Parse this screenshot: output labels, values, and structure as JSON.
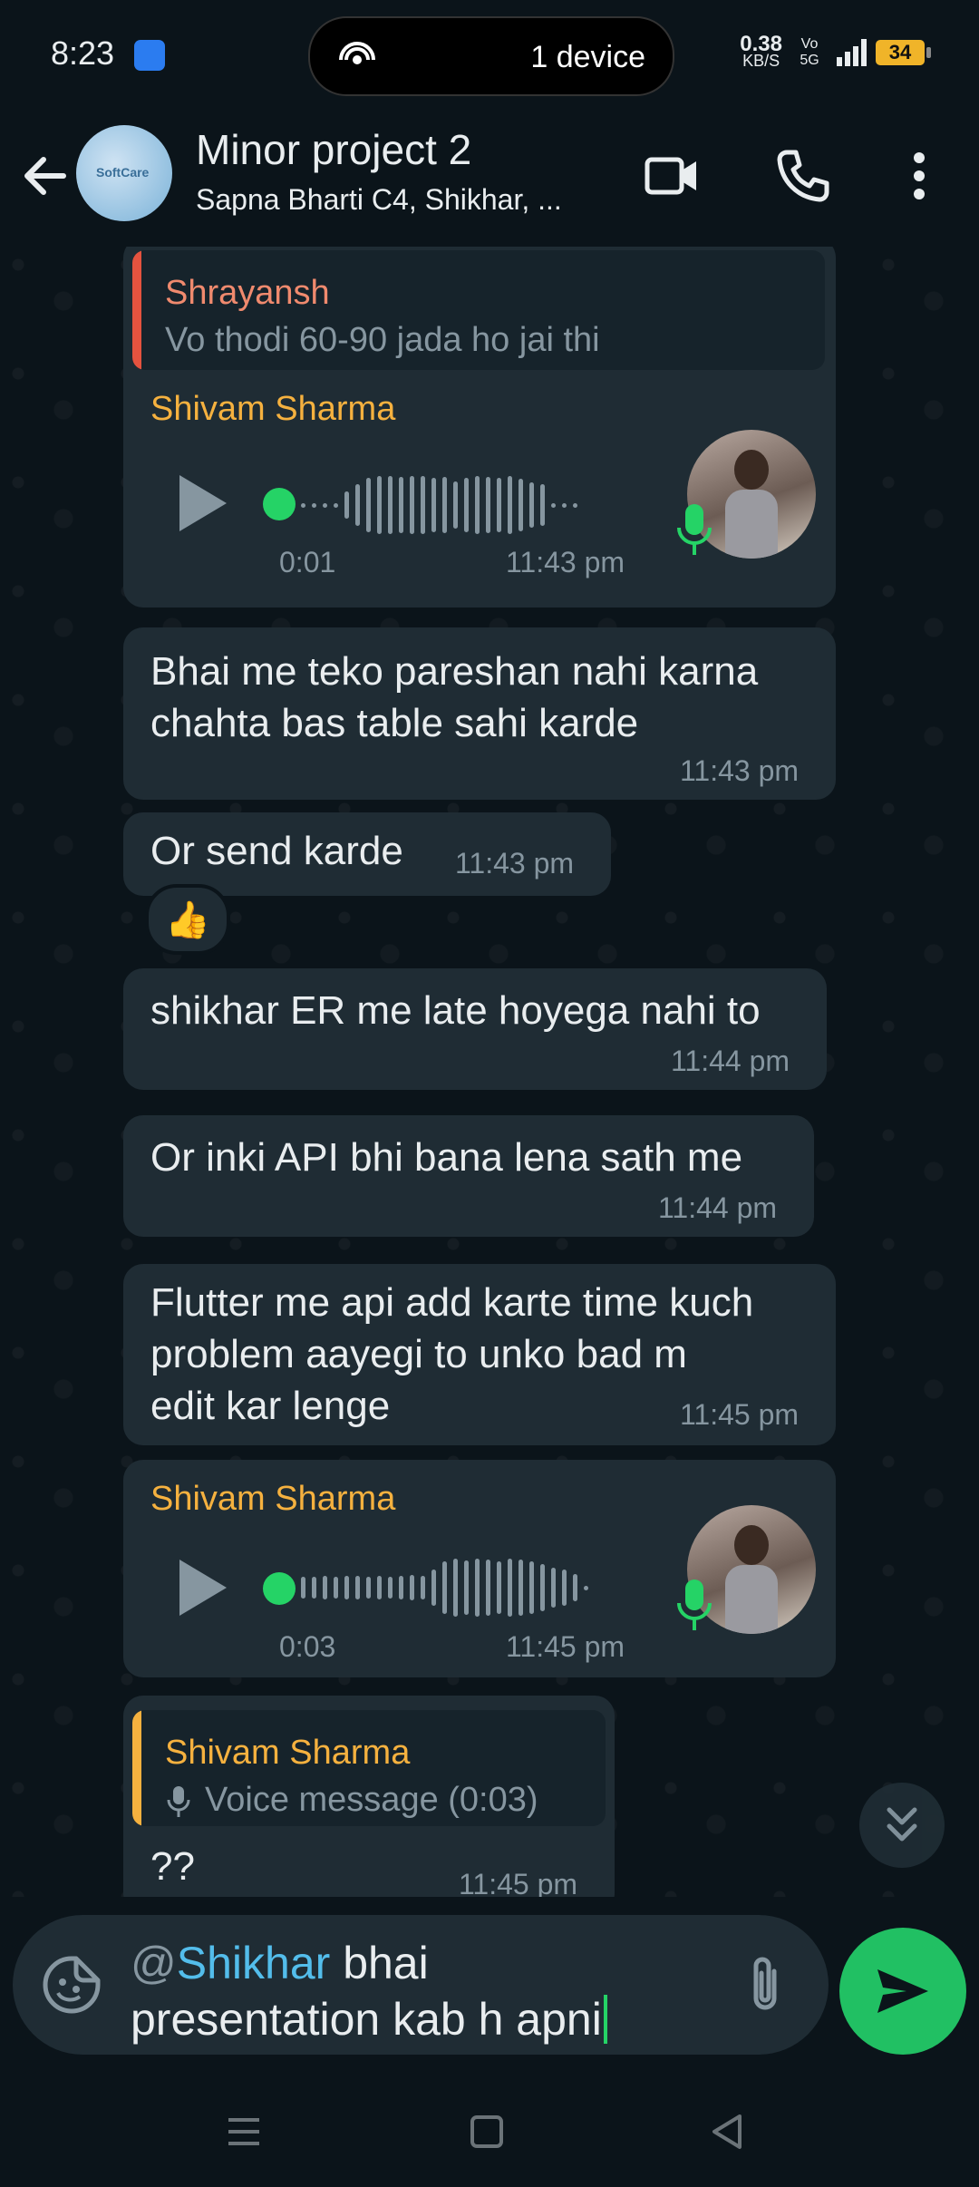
{
  "status_bar": {
    "time": "8:23",
    "device_label": "1 device",
    "net_speed": "0.38",
    "net_unit": "KB/S",
    "volte": "Vo 5G",
    "network": "5G",
    "battery": "34"
  },
  "header": {
    "avatar_text": "SoftCare",
    "title": "Minor project 2",
    "subtitle": "Sapna Bharti C4, Shikhar, ..."
  },
  "messages": [
    {
      "quote_name": "Shrayansh",
      "quote_text": "Vo thodi 60-90 jada ho jai thi",
      "sender": "Shivam Sharma",
      "voice_duration": "0:01",
      "time": "11:43 pm"
    },
    {
      "text_line1": "Bhai me teko pareshan nahi karna",
      "text_line2": "chahta bas table sahi karde",
      "time": "11:43 pm"
    },
    {
      "text": "Or send karde",
      "time": "11:43 pm",
      "reaction": "👍"
    },
    {
      "text": "shikhar ER me late hoyega nahi to",
      "time": "11:44 pm"
    },
    {
      "text": "Or inki API bhi bana lena sath me",
      "time": "11:44 pm"
    },
    {
      "text_line1": "Flutter me api add karte time kuch",
      "text_line2": "problem aayegi to unko bad m",
      "text_line3": "edit kar lenge",
      "time": "11:45 pm"
    },
    {
      "sender": "Shivam Sharma",
      "voice_duration": "0:03",
      "time": "11:45 pm"
    },
    {
      "quote_name": "Shivam Sharma",
      "quote_text": "Voice message (0:03)",
      "text": "??",
      "time": "11:45 pm"
    }
  ],
  "compose": {
    "at": "@",
    "mention": "Shikhar",
    "text_line1_rest": " bhai",
    "text_line2": "presentation kab h apni"
  },
  "colors": {
    "background": "#0b141a",
    "bubble": "#1f2c34",
    "accent_green": "#21c063",
    "sender_orange": "#f5b13f",
    "quote_bar_red": "#e5533f",
    "mention_blue": "#53bdeb"
  }
}
